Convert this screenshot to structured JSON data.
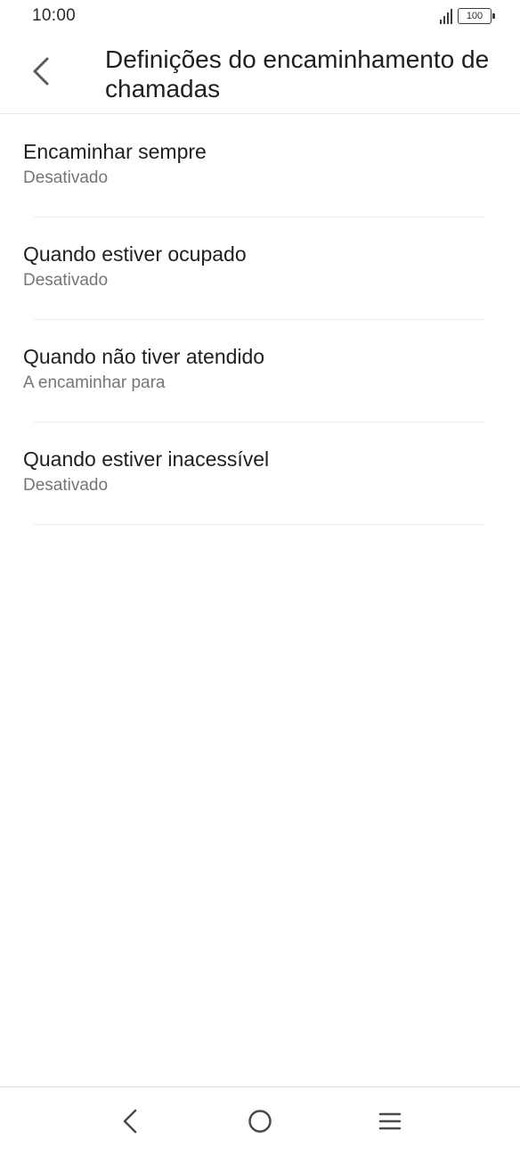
{
  "status_bar": {
    "time": "10:00",
    "battery_level": "100",
    "icons": [
      "signal-icon",
      "battery-icon"
    ]
  },
  "header": {
    "back_icon": "chevron-left-icon",
    "title": "Definições do encaminhamento de chamadas"
  },
  "forwarding_options": [
    {
      "title": "Encaminhar sempre",
      "subtitle": "Desativado"
    },
    {
      "title": "Quando estiver ocupado",
      "subtitle": "Desativado"
    },
    {
      "title": "Quando não tiver atendido",
      "subtitle": "A encaminhar para"
    },
    {
      "title": "Quando estiver inacessível",
      "subtitle": "Desativado"
    }
  ],
  "nav_bar": {
    "icons": [
      "nav-back-icon",
      "nav-home-icon",
      "nav-menu-icon"
    ]
  },
  "colors": {
    "primary_text": "#1f1f1f",
    "secondary_text": "#757575",
    "divider": "#ececec",
    "background": "#ffffff"
  }
}
